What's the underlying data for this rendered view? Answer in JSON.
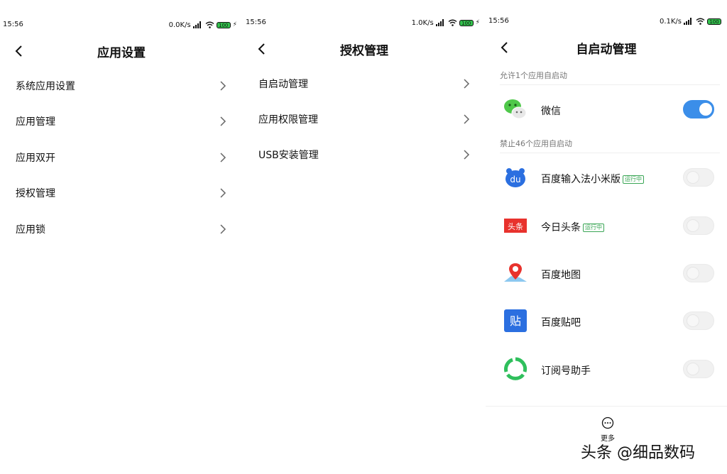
{
  "screen1": {
    "status": {
      "time": "15:56",
      "speed": "0.0K/s",
      "battery": "100"
    },
    "title": "应用设置",
    "items": [
      {
        "label": "系统应用设置"
      },
      {
        "label": "应用管理"
      },
      {
        "label": "应用双开"
      },
      {
        "label": "授权管理"
      },
      {
        "label": "应用锁"
      }
    ]
  },
  "screen2": {
    "status": {
      "time": "15:56",
      "speed": "1.0K/s",
      "battery": "100"
    },
    "title": "授权管理",
    "items": [
      {
        "label": "自启动管理"
      },
      {
        "label": "应用权限管理"
      },
      {
        "label": "USB安装管理"
      }
    ]
  },
  "screen3": {
    "status": {
      "time": "15:56",
      "speed": "0.1K/s",
      "battery": "100"
    },
    "title": "自启动管理",
    "allowed_header": "允许1个应用自启动",
    "blocked_header": "禁止46个应用自启动",
    "allowed_apps": [
      {
        "name": "微信",
        "enabled": true,
        "icon": "wechat-icon"
      }
    ],
    "blocked_apps": [
      {
        "name": "百度输入法小米版",
        "badge": "运行中",
        "enabled": false,
        "icon": "baidu-input-icon"
      },
      {
        "name": "今日头条",
        "badge": "运行中",
        "enabled": false,
        "icon": "toutiao-icon"
      },
      {
        "name": "百度地图",
        "enabled": false,
        "icon": "baidu-map-icon"
      },
      {
        "name": "百度贴吧",
        "enabled": false,
        "icon": "baidu-tieba-icon"
      },
      {
        "name": "订阅号助手",
        "enabled": false,
        "icon": "subscription-assistant-icon"
      }
    ],
    "more_label": "更多"
  },
  "watermark": "头条 @细品数码",
  "colors": {
    "toggle_on": "#3b8ee9",
    "badge": "#3aa655",
    "battery": "#33c24d"
  }
}
